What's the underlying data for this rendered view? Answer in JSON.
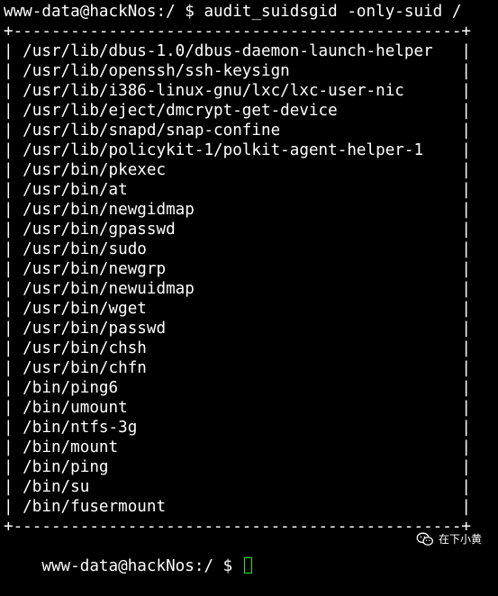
{
  "terminal": {
    "prompt_command": "www-data@hackNos:/ $ audit_suidsgid -only-suid /",
    "border_top": "+-----------------------------------------------+",
    "rows": [
      "| /usr/lib/dbus-1.0/dbus-daemon-launch-helper   |",
      "| /usr/lib/openssh/ssh-keysign                  |",
      "| /usr/lib/i386-linux-gnu/lxc/lxc-user-nic      |",
      "| /usr/lib/eject/dmcrypt-get-device             |",
      "| /usr/lib/snapd/snap-confine                   |",
      "| /usr/lib/policykit-1/polkit-agent-helper-1    |",
      "| /usr/bin/pkexec                               |",
      "| /usr/bin/at                                   |",
      "| /usr/bin/newgidmap                            |",
      "| /usr/bin/gpasswd                              |",
      "| /usr/bin/sudo                                 |",
      "| /usr/bin/newgrp                               |",
      "| /usr/bin/newuidmap                            |",
      "| /usr/bin/wget                                 |",
      "| /usr/bin/passwd                               |",
      "| /usr/bin/chsh                                 |",
      "| /usr/bin/chfn                                 |",
      "| /bin/ping6                                    |",
      "| /bin/umount                                   |",
      "| /bin/ntfs-3g                                  |",
      "| /bin/mount                                    |",
      "| /bin/ping                                     |",
      "| /bin/su                                       |",
      "| /bin/fusermount                               |"
    ],
    "border_bottom": "+-----------------------------------------------+",
    "prompt_final": "www-data@hackNos:/ $ ",
    "cursor_color": "#28e128"
  },
  "watermark": {
    "icon": "wechat-icon",
    "text": "在下小黄"
  }
}
